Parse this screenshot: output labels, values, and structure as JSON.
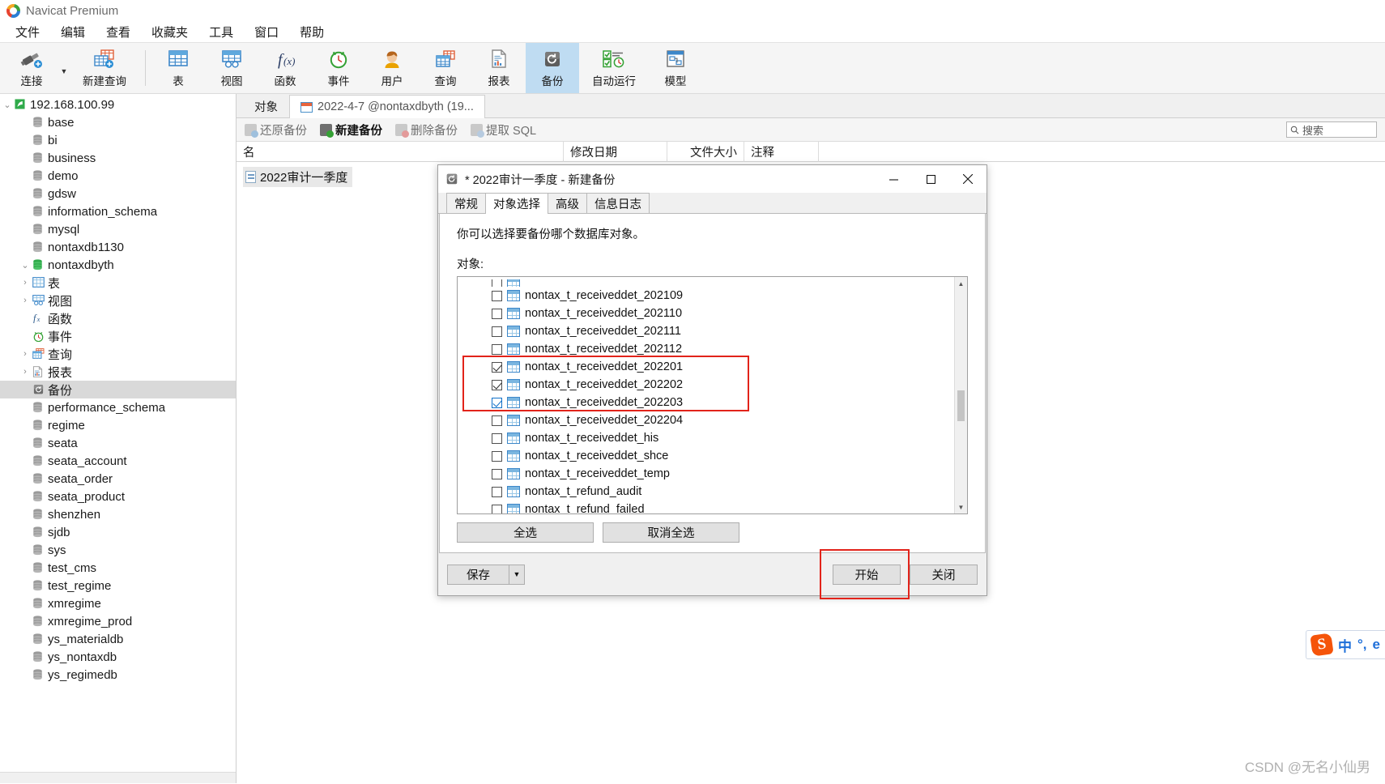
{
  "window": {
    "title": "Navicat Premium"
  },
  "menubar": {
    "items": [
      "文件",
      "编辑",
      "查看",
      "收藏夹",
      "工具",
      "窗口",
      "帮助"
    ]
  },
  "toolbar": {
    "items": [
      {
        "label": "连接",
        "icon": "connection-icon",
        "active": false
      },
      {
        "label": "新建查询",
        "icon": "new-query-icon",
        "active": false
      },
      {
        "label": "表",
        "icon": "table-icon",
        "active": false
      },
      {
        "label": "视图",
        "icon": "view-icon",
        "active": false
      },
      {
        "label": "函数",
        "icon": "function-icon",
        "active": false
      },
      {
        "label": "事件",
        "icon": "event-icon",
        "active": false
      },
      {
        "label": "用户",
        "icon": "user-icon",
        "active": false
      },
      {
        "label": "查询",
        "icon": "query-icon",
        "active": false
      },
      {
        "label": "报表",
        "icon": "report-icon",
        "active": false
      },
      {
        "label": "备份",
        "icon": "backup-icon",
        "active": true
      },
      {
        "label": "自动运行",
        "icon": "automation-icon",
        "active": false
      },
      {
        "label": "模型",
        "icon": "model-icon",
        "active": false
      }
    ]
  },
  "sidebar": {
    "connection": "192.168.100.99",
    "databases_top": [
      "base",
      "bi",
      "business",
      "demo",
      "gdsw",
      "information_schema",
      "mysql",
      "nontaxdb1130"
    ],
    "expanded_db": "nontaxdbyth",
    "expanded_children": [
      {
        "label": "表",
        "icon": "table-icon",
        "arrow": true,
        "selected": false
      },
      {
        "label": "视图",
        "icon": "view-icon",
        "arrow": true,
        "selected": false
      },
      {
        "label": "函数",
        "icon": "function-icon",
        "arrow": false,
        "selected": false
      },
      {
        "label": "事件",
        "icon": "event-icon",
        "arrow": false,
        "selected": false
      },
      {
        "label": "查询",
        "icon": "query-icon",
        "arrow": true,
        "selected": false
      },
      {
        "label": "报表",
        "icon": "report-icon",
        "arrow": true,
        "selected": false
      },
      {
        "label": "备份",
        "icon": "backup-icon",
        "arrow": false,
        "selected": true
      }
    ],
    "databases_bottom": [
      "performance_schema",
      "regime",
      "seata",
      "seata_account",
      "seata_order",
      "seata_product",
      "shenzhen",
      "sjdb",
      "sys",
      "test_cms",
      "test_regime",
      "xmregime",
      "xmregime_prod",
      "ys_materialdb",
      "ys_nontaxdb",
      "ys_regimedb"
    ]
  },
  "main": {
    "tabs": [
      {
        "label": "对象",
        "active": false,
        "has_icon": false
      },
      {
        "label": "2022-4-7 @nontaxdbyth (19...",
        "active": true,
        "has_icon": true
      }
    ],
    "actions": [
      {
        "label": "还原备份",
        "icon": "restore-backup-icon",
        "strong": false
      },
      {
        "label": "新建备份",
        "icon": "new-backup-icon",
        "strong": true
      },
      {
        "label": "删除备份",
        "icon": "delete-backup-icon",
        "strong": false
      },
      {
        "label": "提取 SQL",
        "icon": "extract-sql-icon",
        "strong": false
      }
    ],
    "search_placeholder": "搜索",
    "columns": [
      "名",
      "修改日期",
      "文件大小",
      "注释"
    ],
    "rows": [
      {
        "name": "2022审计一季度",
        "modified": "",
        "size": "",
        "comment": ""
      }
    ]
  },
  "dialog": {
    "title": "* 2022审计一季度 - 新建备份",
    "icon": "backup-icon",
    "window_buttons": [
      "minimize",
      "maximize",
      "close"
    ],
    "tabs": [
      {
        "label": "常规",
        "active": false
      },
      {
        "label": "对象选择",
        "active": true
      },
      {
        "label": "高级",
        "active": false
      },
      {
        "label": "信息日志",
        "active": false
      }
    ],
    "hint": "你可以选择要备份哪个数据库对象。",
    "objects_label": "对象:",
    "objects": [
      {
        "name": "nontax_t_receiveddet_202109",
        "checked": false,
        "highlight": false
      },
      {
        "name": "nontax_t_receiveddet_202110",
        "checked": false,
        "highlight": false
      },
      {
        "name": "nontax_t_receiveddet_202111",
        "checked": false,
        "highlight": false
      },
      {
        "name": "nontax_t_receiveddet_202112",
        "checked": false,
        "highlight": false
      },
      {
        "name": "nontax_t_receiveddet_202201",
        "checked": true,
        "highlight": true
      },
      {
        "name": "nontax_t_receiveddet_202202",
        "checked": true,
        "highlight": true
      },
      {
        "name": "nontax_t_receiveddet_202203",
        "checked": true,
        "highlight": true
      },
      {
        "name": "nontax_t_receiveddet_202204",
        "checked": false,
        "highlight": false
      },
      {
        "name": "nontax_t_receiveddet_his",
        "checked": false,
        "highlight": false
      },
      {
        "name": "nontax_t_receiveddet_shce",
        "checked": false,
        "highlight": false
      },
      {
        "name": "nontax_t_receiveddet_temp",
        "checked": false,
        "highlight": false
      },
      {
        "name": "nontax_t_refund_audit",
        "checked": false,
        "highlight": false
      },
      {
        "name": "nontax_t_refund_failed",
        "checked": false,
        "highlight": false
      }
    ],
    "select_all_label": "全选",
    "deselect_all_label": "取消全选",
    "save_label": "保存",
    "start_label": "开始",
    "close_label": "关闭"
  },
  "ime": {
    "mode": "中",
    "punct": "°,",
    "browser": "e"
  },
  "watermark": "CSDN @无名小仙男",
  "colors": {
    "accent": "#0078d7",
    "toolbar_active_bg": "#bfdcf2",
    "highlight_box": "#e2231a",
    "tree_selected_bg": "#d9d9d9"
  }
}
